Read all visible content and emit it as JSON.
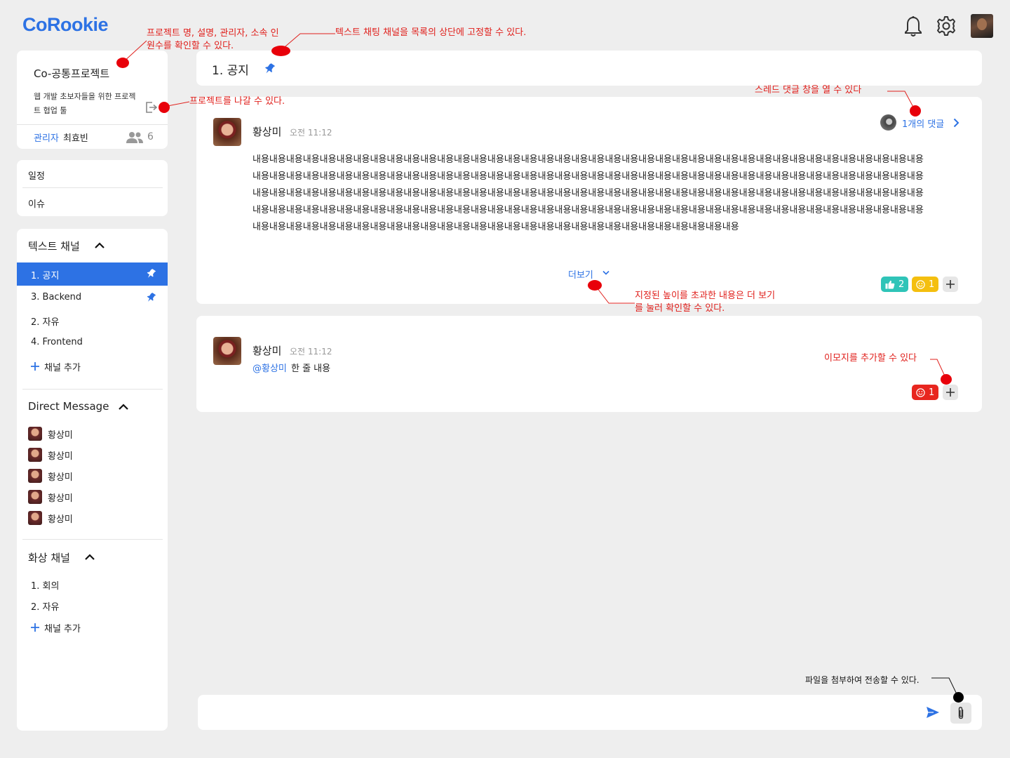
{
  "header": {
    "logo": "CoRookie",
    "icons": [
      "bell-icon",
      "gear-icon",
      "avatar"
    ]
  },
  "project": {
    "name": "Co-공통프로젝트",
    "description": "웹 개발 초보자들을 위한 프로젝트 협업 툴",
    "admin_label": "관리자",
    "admin_name": "최효빈",
    "member_count": "6"
  },
  "menu": {
    "items": [
      {
        "label": "일정"
      },
      {
        "label": "이슈"
      }
    ]
  },
  "text_channels": {
    "title": "텍스트 채널",
    "items": [
      {
        "label": "1. 공지",
        "pinned": true,
        "active": true
      },
      {
        "label": "3. Backend",
        "pinned": true,
        "active": false
      },
      {
        "label": "2. 자유",
        "pinned": false,
        "active": false
      },
      {
        "label": "4. Frontend",
        "pinned": false,
        "active": false
      }
    ],
    "add_label": "채널 추가"
  },
  "direct_message": {
    "title": "Direct Message",
    "users": [
      {
        "name": "황상미"
      },
      {
        "name": "황상미"
      },
      {
        "name": "황상미"
      },
      {
        "name": "황상미"
      },
      {
        "name": "황상미"
      }
    ]
  },
  "video_channels": {
    "title": "화상 채널",
    "items": [
      {
        "label": "1. 회의"
      },
      {
        "label": "2. 자유"
      }
    ],
    "add_label": "채널 추가"
  },
  "channel_header": {
    "title": "1. 공지"
  },
  "messages": [
    {
      "author": "황상미",
      "time": "오전 11:12",
      "body": "내용내용내용내용내용내용내용내용내용내용내용내용내용내용내용내용내용내용내용내용내용내용내용내용내용내용내용내용내용내용내용내용내용내용내용내용내용내용내용내용내용내용내용내용내용내용내용내용내용내용내용내용내용내용내용내용내용내용내용내용내용내용내용내용내용내용내용내용내용내용내용내용내용내용내용내용내용내용내용내용내용내용내용내용내용내용내용내용내용내용내용내용내용내용내용내용내용내용내용내용내용내용내용내용내용내용내용내용내용내용내용내용내용내용내용내용내용내용내용내용내용내용내용내용내용내용내용내용내용내용내용내용내용내용내용내용내용내용내용내용내용내용내용내용내용내용내용내용내용내용내용내용내용내용내용내용내용내용내용내용내용내용내용내용내용내용내용내용내용내용내용내용내용내용내용내용내용내용내용내용내용내용내용내용내용내용내용내용내용",
      "more_label": "더보기",
      "reply_label": "1개의 댓글",
      "reactions": [
        {
          "icon": "thumbs-up-icon",
          "count": "2",
          "color": "#2fc4b8"
        },
        {
          "icon": "smile-icon",
          "count": "1",
          "color": "#f4bf0f"
        }
      ]
    },
    {
      "author": "황상미",
      "time": "오전 11:12",
      "mention": "@황상미",
      "body": "한 줄 내용",
      "reactions": [
        {
          "icon": "smile-icon",
          "count": "1",
          "color": "#e8261f"
        }
      ]
    }
  ],
  "composer": {
    "placeholder": "",
    "icons": [
      "send-icon",
      "paperclip-icon"
    ]
  },
  "annotations": {
    "project_info": "프로젝트 명, 설명, 관리자, 소속 인원수를 확인할 수 있다.",
    "pin_channel": "텍스트 채팅 채널을 목록의 상단에 고정할 수 있다.",
    "leave_project": "프로젝트를 나갈 수 있다.",
    "thread": "스레드 댓글 창을 열 수 있다",
    "more": "지정된 높이를 초과한 내용은 더 보기를 눌러 확인할 수 있다.",
    "emoji": "이모지를 추가할 수 있다",
    "attach": "파일을 첨부하여 전송할 수 있다."
  },
  "colors": {
    "accent": "#2d72e4",
    "annotation": "#e0201c",
    "background": "#eeeeee"
  }
}
